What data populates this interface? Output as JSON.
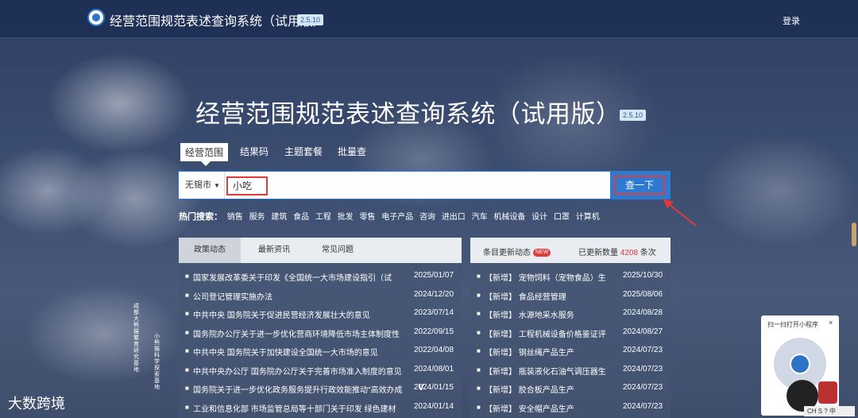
{
  "header": {
    "title": "经营范围规范表述查询系统（试用版）",
    "version": "2.5.10",
    "login": "登录"
  },
  "hero": {
    "title": "经营范围规范表述查询系统（试用版）",
    "version": "2.5.10"
  },
  "tabs": [
    {
      "label": "经营范围"
    },
    {
      "label": "结果码"
    },
    {
      "label": "主题套餐"
    },
    {
      "label": "批量查"
    }
  ],
  "search": {
    "city": "无锡市",
    "query": "小吃",
    "button": "查一下"
  },
  "hot": {
    "label": "热门搜索：",
    "keywords": [
      "销售",
      "服务",
      "建筑",
      "食品",
      "工程",
      "批发",
      "零售",
      "电子产品",
      "咨询",
      "进出口",
      "汽车",
      "机械设备",
      "设计",
      "口罩",
      "计算机"
    ]
  },
  "news_panel": {
    "tabs": [
      "政策动态",
      "最新资讯",
      "常见问题"
    ],
    "items": [
      {
        "title": "国家发展改革委关于印发《全国统一大市场建设指引（试",
        "date": "2025/01/07"
      },
      {
        "title": "公司登记管理实施办法",
        "date": "2024/12/20"
      },
      {
        "title": "中共中央 国务院关于促进民营经济发展壮大的意见",
        "date": "2023/07/14"
      },
      {
        "title": "国务院办公厅关于进一步优化营商环境降低市场主体制度性",
        "date": "2022/09/15"
      },
      {
        "title": "中共中央 国务院关于加快建设全国统一大市场的意见",
        "date": "2022/04/08"
      },
      {
        "title": "中共中央办公厅 国务院办公厅关于完善市场准入制度的意见",
        "date": "2024/08/01"
      },
      {
        "title": "国务院关于进一步优化政务服务提升行政效能推动\"高效办成",
        "date": "2024/01/15"
      },
      {
        "title": "工业和信息化部 市场监管总局等十部门关于印发 绿色建材",
        "date": "2024/01/14"
      }
    ]
  },
  "updates_panel": {
    "heading": "条目更新动态",
    "new_badge": "NEW",
    "count_label": "已更新数量",
    "count": "4208",
    "count_unit": "条次",
    "items": [
      {
        "title": "【新增】 宠物饲料（宠物食品）生",
        "date": "2025/10/30"
      },
      {
        "title": "【新增】 食品经营管理",
        "date": "2025/08/06"
      },
      {
        "title": "【新增】 水源地采水服务",
        "date": "2024/08/28"
      },
      {
        "title": "【新增】 工程机械设备价格鉴证评",
        "date": "2024/08/27"
      },
      {
        "title": "【新增】 钢丝绳产品生产",
        "date": "2024/07/23"
      },
      {
        "title": "【新增】 瓶装液化石油气调压器生",
        "date": "2024/07/23"
      },
      {
        "title": "【新增】 胶合板产品生产",
        "date": "2024/07/23"
      },
      {
        "title": "【新增】 安全帽产品生产",
        "date": "2024/07/23"
      }
    ]
  },
  "side_text": {
    "a": "成都大熊猫繁育研究基地",
    "b": "小熊猫科学探索基地"
  },
  "watermark": "大数跨境",
  "qr": {
    "title": "扫一扫打开小程序",
    "close": "×"
  },
  "ime": "CH S ? 中"
}
